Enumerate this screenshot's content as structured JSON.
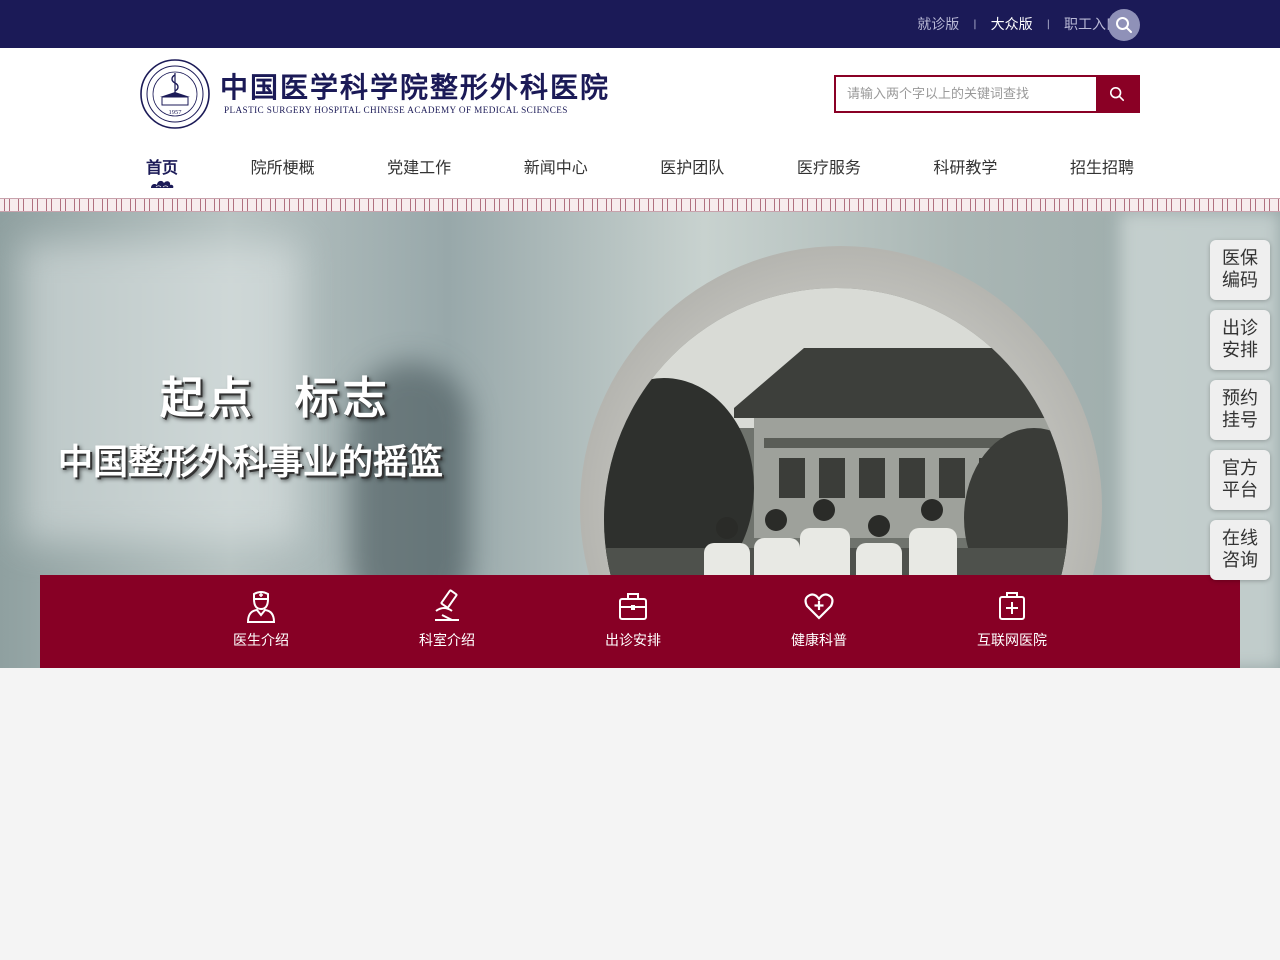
{
  "topbar": {
    "links": [
      {
        "label": "就诊版"
      },
      {
        "label": "大众版"
      },
      {
        "label": "职工入口"
      }
    ],
    "separator": "|"
  },
  "header": {
    "logo_cn": "中国医学科学院整形外科医院",
    "logo_en": "PLASTIC SURGERY HOSPITAL CHINESE ACADEMY OF MEDICAL SCIENCES",
    "logo_year": "1957",
    "search_placeholder": "请输入两个字以上的关键词查找"
  },
  "nav": [
    {
      "label": "首页",
      "active": true
    },
    {
      "label": "院所梗概"
    },
    {
      "label": "党建工作"
    },
    {
      "label": "新闻中心"
    },
    {
      "label": "医护团队"
    },
    {
      "label": "医疗服务"
    },
    {
      "label": "科研教学"
    },
    {
      "label": "招生招聘"
    }
  ],
  "banner": {
    "title": "起点  标志",
    "subtitle": "中国整形外科事业的摇篮"
  },
  "quicklinks": [
    {
      "label": "医生介绍",
      "icon": "doctor-icon"
    },
    {
      "label": "科室介绍",
      "icon": "microscope-icon"
    },
    {
      "label": "出诊安排",
      "icon": "briefcase-icon"
    },
    {
      "label": "健康科普",
      "icon": "heart-plus-icon"
    },
    {
      "label": "互联网医院",
      "icon": "medical-bag-icon"
    }
  ],
  "side_buttons": [
    {
      "line1": "医保",
      "line2": "编码"
    },
    {
      "line1": "出诊",
      "line2": "安排"
    },
    {
      "line1": "预约",
      "line2": "挂号"
    },
    {
      "line1": "官方",
      "line2": "平台"
    },
    {
      "line1": "在线",
      "line2": "咨询"
    }
  ],
  "colors": {
    "navy": "#1b1a57",
    "maroon": "#870025",
    "background": "#f4f4f4"
  }
}
